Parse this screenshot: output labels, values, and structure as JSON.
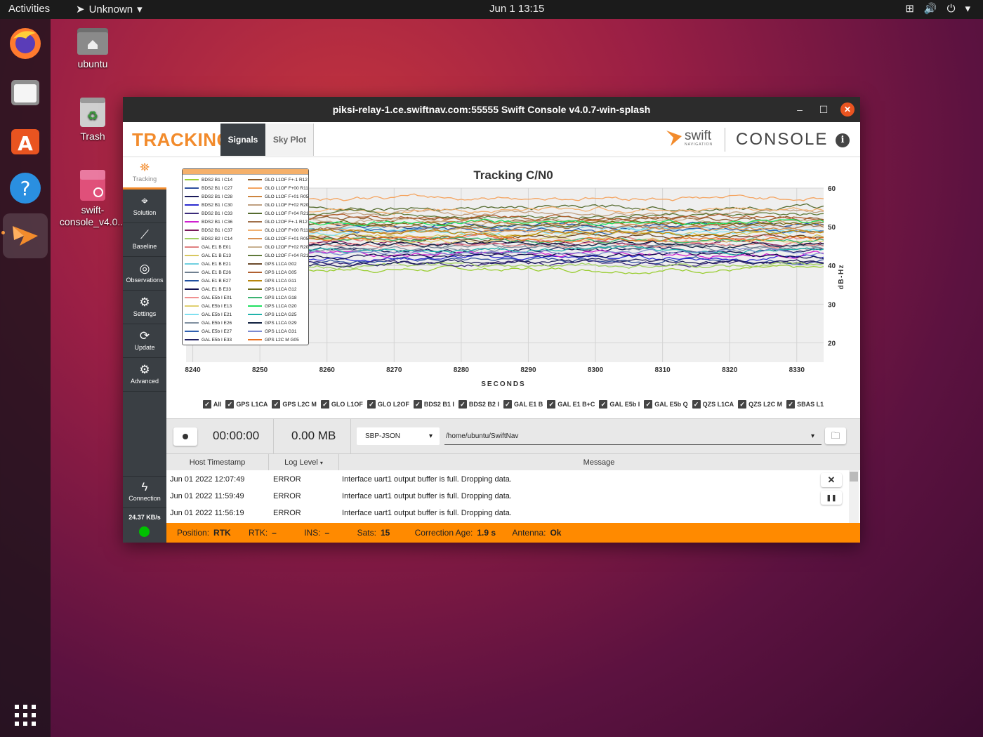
{
  "topbar": {
    "activities": "Activities",
    "app_menu": "Unknown",
    "clock": "Jun 1  13:15"
  },
  "desktop": [
    {
      "label": "ubuntu",
      "icon": "home-folder-icon"
    },
    {
      "label": "Trash",
      "icon": "trash-icon"
    },
    {
      "label": "swift-console_v4.0...",
      "icon": "deb-package-icon"
    }
  ],
  "dock": [
    "firefox-icon",
    "files-icon",
    "software-icon",
    "help-icon",
    "swift-console-icon",
    "show-apps-icon"
  ],
  "window": {
    "title": "piksi-relay-1.ce.swiftnav.com:55555 Swift Console v4.0.7-win-splash",
    "minimize": "–",
    "maximize": "☐",
    "close": "✕"
  },
  "header": {
    "section": "TRACKING",
    "tabs": [
      {
        "label": "Signals",
        "active": true
      },
      {
        "label": "Sky Plot",
        "active": false
      }
    ],
    "brand": "swift",
    "brand_sub": "NAVIGATION",
    "console": "CONSOLE",
    "info": "i"
  },
  "sidebar": {
    "items": [
      {
        "label": "Tracking",
        "icon": "satellite-dish-icon"
      },
      {
        "label": "Solution",
        "icon": "location-pin-icon"
      },
      {
        "label": "Baseline",
        "icon": "baseline-icon"
      },
      {
        "label": "Observations",
        "icon": "globe-icon"
      },
      {
        "label": "Settings",
        "icon": "gear-icon"
      },
      {
        "label": "Update",
        "icon": "update-icon"
      },
      {
        "label": "Advanced",
        "icon": "advanced-gear-icon"
      }
    ],
    "connection": "Connection",
    "rate": "24.37  KB/s"
  },
  "chart_data": {
    "type": "line",
    "title": "Tracking C/N0",
    "xlabel": "SECONDS",
    "ylabel": "dB-Hz",
    "xlim": [
      8239,
      8334
    ],
    "ylim": [
      15,
      60
    ],
    "xticks": [
      8240,
      8250,
      8260,
      8270,
      8280,
      8290,
      8300,
      8310,
      8320,
      8330
    ],
    "yticks": [
      20,
      30,
      40,
      50,
      60
    ],
    "grid": true,
    "legend_placement": "top-left",
    "series": [
      {
        "name": "BDS2 B1 I C14",
        "color": "#9acd32",
        "level": 39.0
      },
      {
        "name": "BDS2 B1 I C27",
        "color": "#2f4f9f",
        "level": 41.5
      },
      {
        "name": "BDS2 B1 I C28",
        "color": "#1a1a5a",
        "level": 44.0
      },
      {
        "name": "BDS2 B1 I C30",
        "color": "#2b2bd0",
        "level": 42.0
      },
      {
        "name": "BDS2 B1 I C33",
        "color": "#3b2b7a",
        "level": 40.5
      },
      {
        "name": "BDS2 B1 I C36",
        "color": "#d020d0",
        "level": 43.0
      },
      {
        "name": "BDS2 B1 I C37",
        "color": "#7a1a5a",
        "level": 46.0
      },
      {
        "name": "BDS2 B2 I C14",
        "color": "#a0d060",
        "level": 40.0
      },
      {
        "name": "GAL E1 B E01",
        "color": "#e08080",
        "level": 47.0
      },
      {
        "name": "GAL E1 B E13",
        "color": "#d8c860",
        "level": 48.0
      },
      {
        "name": "GAL E1 B E21",
        "color": "#70d0e0",
        "level": 49.5
      },
      {
        "name": "GAL E1 B E26",
        "color": "#708090",
        "level": 45.0
      },
      {
        "name": "GAL E1 B E27",
        "color": "#2050a0",
        "level": 50.5
      },
      {
        "name": "GAL E1 B E33",
        "color": "#101050",
        "level": 42.5
      },
      {
        "name": "GAL E5b I E01",
        "color": "#f09090",
        "level": 45.5
      },
      {
        "name": "GAL E5b I E13",
        "color": "#e0d070",
        "level": 46.5
      },
      {
        "name": "GAL E5b I E21",
        "color": "#80e0f0",
        "level": 48.5
      },
      {
        "name": "GAL E5b I E26",
        "color": "#8090a0",
        "level": 44.5
      },
      {
        "name": "GAL E5b I E27",
        "color": "#3060b0",
        "level": 49.0
      },
      {
        "name": "GAL E5b I E33",
        "color": "#202060",
        "level": 41.0
      },
      {
        "name": "GLO L1OF F+-1 R12",
        "color": "#8b5a2b",
        "level": 52.0
      },
      {
        "name": "GLO L1OF F+00 R11",
        "color": "#f4a460",
        "level": 57.5
      },
      {
        "name": "GLO L1OF F+01 R05",
        "color": "#cd853f",
        "level": 51.0
      },
      {
        "name": "GLO L1OF F+02 R20",
        "color": "#c0a080",
        "level": 53.5
      },
      {
        "name": "GLO L1OF F+04 R21",
        "color": "#556b2f",
        "level": 55.0
      },
      {
        "name": "GLO L2OF F+-1 R12",
        "color": "#a0704a",
        "level": 50.0
      },
      {
        "name": "GLO L2OF F+00 R11",
        "color": "#f0b070",
        "level": 54.5
      },
      {
        "name": "GLO L2OF F+01 R05",
        "color": "#d89050",
        "level": 49.0
      },
      {
        "name": "GLO L2OF F+02 R20",
        "color": "#c8b090",
        "level": 51.5
      },
      {
        "name": "GLO L2OF F+04 R21",
        "color": "#607a3a",
        "level": 53.0
      },
      {
        "name": "GPS L1CA G02",
        "color": "#6b4a2a",
        "level": 47.5
      },
      {
        "name": "GPS L1CA G05",
        "color": "#b06030",
        "level": 52.5
      },
      {
        "name": "GPS L1CA G11",
        "color": "#b8860b",
        "level": 48.5
      },
      {
        "name": "GPS L1CA G12",
        "color": "#6b6b1a",
        "level": 50.5
      },
      {
        "name": "GPS L1CA G18",
        "color": "#3cb371",
        "level": 46.5
      },
      {
        "name": "GPS L1CA G20",
        "color": "#20e060",
        "level": 51.0
      },
      {
        "name": "GPS L1CA G25",
        "color": "#20b2aa",
        "level": 44.0
      },
      {
        "name": "GPS L1CA G29",
        "color": "#102040",
        "level": 45.5
      },
      {
        "name": "GPS L1CA G31",
        "color": "#7b8ad0",
        "level": 43.5
      },
      {
        "name": "GPS L2C M G05",
        "color": "#e87020",
        "level": 47.0
      }
    ]
  },
  "filters": [
    "All",
    "GPS L1CA",
    "GPS L2C M",
    "GLO L1OF",
    "GLO L2OF",
    "BDS2 B1 I",
    "BDS2 B2 I",
    "GAL E1 B",
    "GAL E1 B+C",
    "GAL E5b I",
    "GAL E5b Q",
    "QZS L1CA",
    "QZS L2C M",
    "SBAS L1"
  ],
  "recording": {
    "elapsed": "00:00:00",
    "size": "0.00 MB",
    "format": "SBP-JSON",
    "path": "/home/ubuntu/SwiftNav"
  },
  "log": {
    "headers": [
      "Host Timestamp",
      "Log Level",
      "Message"
    ],
    "rows": [
      [
        "Jun 01 2022 12:07:49",
        "ERROR",
        "Interface uart1 output buffer is full. Dropping data."
      ],
      [
        "Jun 01 2022 11:59:49",
        "ERROR",
        "Interface uart1 output buffer is full. Dropping data."
      ],
      [
        "Jun 01 2022 11:56:19",
        "ERROR",
        "Interface uart1 output buffer is full. Dropping data."
      ]
    ]
  },
  "status": {
    "position_label": "Position:",
    "position": "RTK",
    "rtk_label": "RTK:",
    "rtk": "–",
    "ins_label": "INS:",
    "ins": "–",
    "sats_label": "Sats:",
    "sats": "15",
    "age_label": "Correction Age:",
    "age": "1.9 s",
    "antenna_label": "Antenna:",
    "antenna": "Ok"
  },
  "colors": {
    "accent": "#f28b2c",
    "status_bar": "#ff8a00",
    "sidebar": "#3a3f44",
    "connected": "#00c000"
  }
}
